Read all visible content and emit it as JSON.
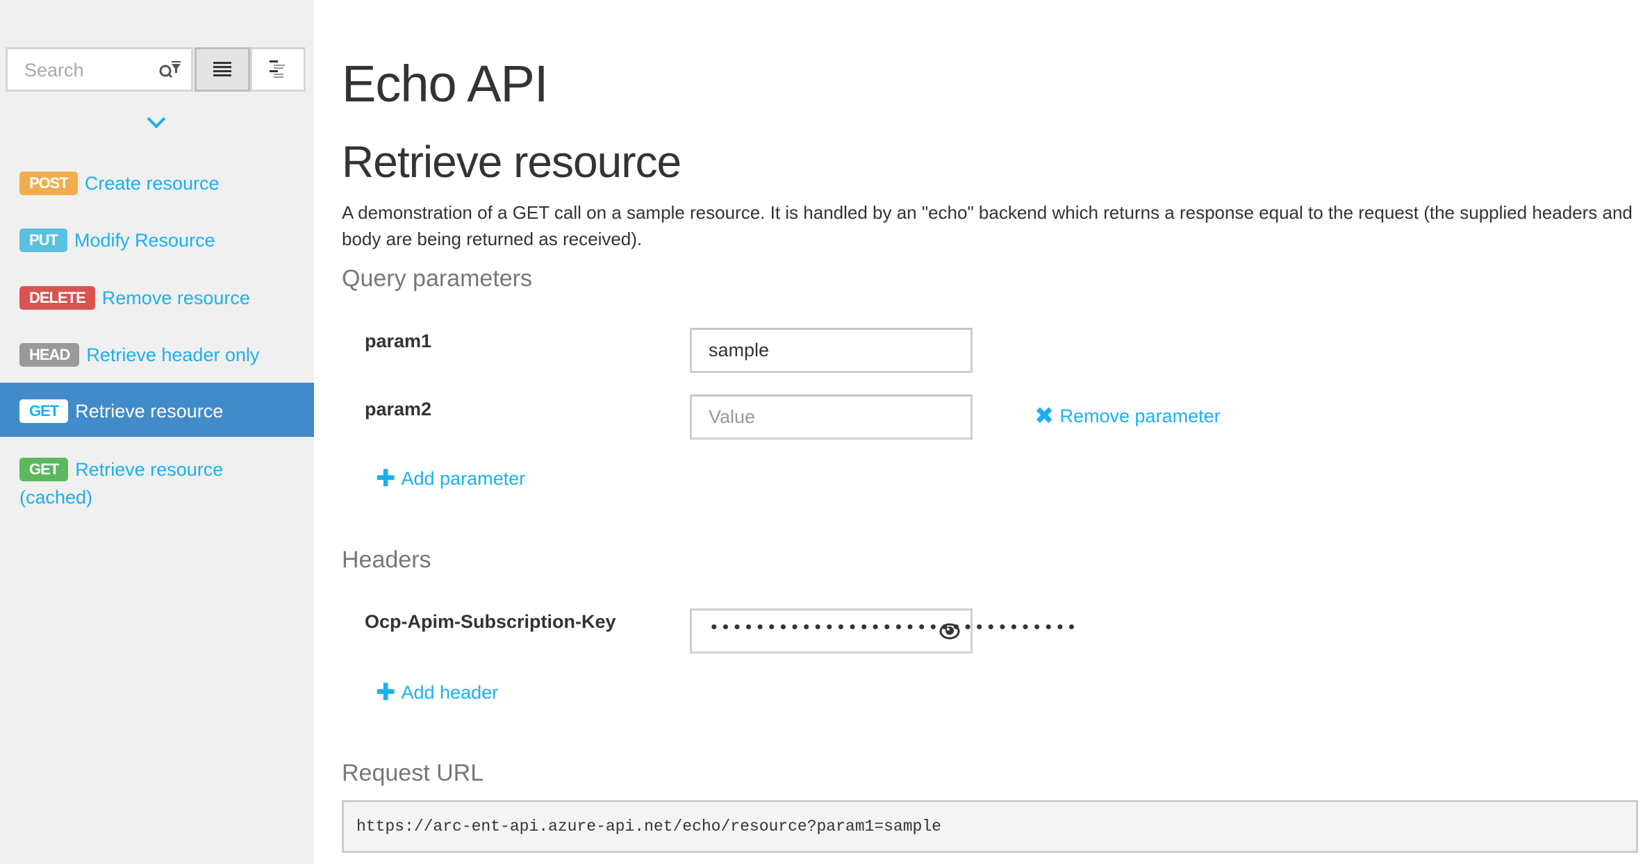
{
  "sidebar": {
    "search": {
      "placeholder": "Search",
      "value": ""
    },
    "icons": {
      "filter": "search-filter-icon",
      "list_view": "list-view-icon",
      "tree_view": "tree-view-icon",
      "expand": "chevron-down-icon"
    },
    "operations": [
      {
        "method": "POST",
        "label": "Create resource",
        "color": "#f0ad4e",
        "selected": false
      },
      {
        "method": "PUT",
        "label": "Modify Resource",
        "color": "#5bc0de",
        "selected": false
      },
      {
        "method": "DELETE",
        "label": "Remove resource",
        "color": "#d9534f",
        "selected": false
      },
      {
        "method": "HEAD",
        "label": "Retrieve header only",
        "color": "#999999",
        "selected": false
      },
      {
        "method": "GET",
        "label": "Retrieve resource",
        "color": "#ffffff",
        "selected": true
      },
      {
        "method": "GET",
        "label": "Retrieve resource (cached)",
        "color": "#5cb85c",
        "selected": false
      }
    ]
  },
  "main": {
    "api_title": "Echo API",
    "operation_title": "Retrieve resource",
    "description": "A demonstration of a GET call on a sample resource. It is handled by an \"echo\" backend which returns a response equal to the request (the supplied headers and body are being returned as received).",
    "query_section": {
      "title": "Query parameters",
      "params": [
        {
          "name": "param1",
          "value": "sample",
          "placeholder": "Value"
        },
        {
          "name": "param2",
          "value": "",
          "placeholder": "Value",
          "remove_label": "Remove parameter"
        }
      ],
      "add_label": "Add parameter"
    },
    "headers_section": {
      "title": "Headers",
      "headers": [
        {
          "name": "Ocp-Apim-Subscription-Key",
          "masked_value": "••••••••••••••••••••••••••••••••"
        }
      ],
      "add_label": "Add header"
    },
    "request_url": {
      "title": "Request URL",
      "value": "https://arc-ent-api.azure-api.net/echo/resource?param1=sample"
    }
  },
  "colors": {
    "link": "#1ab0f0",
    "selected_bg": "#428bca",
    "sidebar_bg": "#f0f0f0"
  }
}
